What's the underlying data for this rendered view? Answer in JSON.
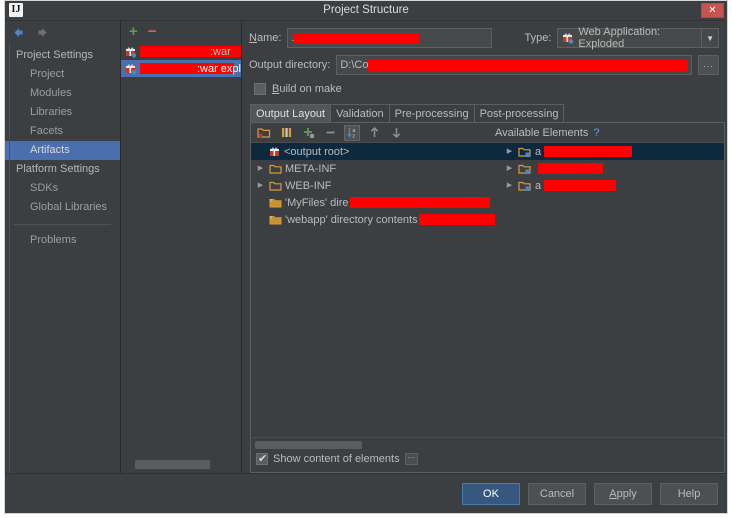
{
  "window": {
    "title": "Project Structure",
    "app_icon": "IJ",
    "close_label": "✕"
  },
  "nav": {
    "back_icon": "arrow-left-icon",
    "forward_icon": "arrow-right-icon",
    "groups": [
      {
        "label": "Project Settings",
        "items": [
          {
            "label": "Project",
            "selected": false
          },
          {
            "label": "Modules",
            "selected": false
          },
          {
            "label": "Libraries",
            "selected": false
          },
          {
            "label": "Facets",
            "selected": false
          },
          {
            "label": "Artifacts",
            "selected": true
          }
        ]
      },
      {
        "label": "Platform Settings",
        "items": [
          {
            "label": "SDKs",
            "selected": false
          },
          {
            "label": "Global Libraries",
            "selected": false
          }
        ]
      }
    ],
    "problems": "Problems"
  },
  "artifacts_panel": {
    "add_label": "+",
    "remove_label": "−",
    "items": [
      {
        "redacted_width": 107,
        "suffix": ":war",
        "selected": false
      },
      {
        "redacted_width": 107,
        "suffix": ":war expl",
        "selected": true
      }
    ]
  },
  "form": {
    "name_label": "Name:",
    "name_value": ".",
    "name_redacted_width": 125,
    "type_label": "Type:",
    "type_value": "Web Application: Exploded",
    "output_dir_label": "Output directory:",
    "output_dir_value": "D:\\Co",
    "output_dir_redacted_width": 337,
    "browse_label": "...",
    "build_on_make_label": "Build on make",
    "build_on_make_checked": false
  },
  "tabs": [
    {
      "label": "Output Layout",
      "active": true
    },
    {
      "label": "Validation",
      "active": false
    },
    {
      "label": "Pre-processing",
      "active": false
    },
    {
      "label": "Post-processing",
      "active": false
    }
  ],
  "layout_toolbar": {
    "buttons": [
      {
        "icon": "add-folder-icon",
        "pressed": false
      },
      {
        "icon": "columns-icon",
        "pressed": false
      },
      {
        "icon": "plus-icon",
        "pressed": false
      },
      {
        "icon": "minus-icon",
        "pressed": false
      },
      {
        "icon": "sort-alphabetical-icon",
        "pressed": true
      },
      {
        "icon": "arrow-up-icon",
        "pressed": false
      },
      {
        "icon": "arrow-down-icon",
        "pressed": false
      }
    ],
    "available_elements_label": "Available Elements",
    "help_label": "?"
  },
  "output_tree": [
    {
      "label": "<output root>",
      "icon": "artifact-icon",
      "twisty": "",
      "selected": true,
      "indent": 0,
      "redacted_width": 0
    },
    {
      "label": "META-INF",
      "icon": "folder-icon",
      "twisty": "▶",
      "selected": false,
      "indent": 0,
      "redacted_width": 0
    },
    {
      "label": "WEB-INF",
      "icon": "folder-icon",
      "twisty": "▶",
      "selected": false,
      "indent": 0,
      "redacted_width": 0
    },
    {
      "label": "'MyFiles' dire",
      "icon": "folder-link-icon",
      "twisty": "",
      "selected": false,
      "indent": 1,
      "redacted_width": 140
    },
    {
      "label": "'webapp' directory contents",
      "icon": "folder-link-icon",
      "twisty": "",
      "selected": false,
      "indent": 1,
      "redacted_width": 82
    }
  ],
  "available_tree": [
    {
      "icon": "module-folder-icon",
      "twisty": "▶",
      "selected": true,
      "prefix": "a",
      "redacted_width": 88
    },
    {
      "icon": "module-folder-icon",
      "twisty": "▶",
      "selected": false,
      "prefix": "",
      "redacted_width": 65
    },
    {
      "icon": "module-folder-icon",
      "twisty": "▶",
      "selected": false,
      "prefix": "a",
      "redacted_width": 72
    }
  ],
  "footer": {
    "show_content_label": "Show content of elements",
    "show_content_checked": true,
    "dots_label": "···"
  },
  "buttons": [
    {
      "label": "OK",
      "default": true
    },
    {
      "label": "Cancel",
      "default": false
    },
    {
      "label": "Apply",
      "default": false,
      "mnemonic": "A"
    },
    {
      "label": "Help",
      "default": false
    }
  ],
  "colors": {
    "window_bg": "#3c3f41",
    "selection_blue": "#4b6eaf",
    "tree_selection": "#0d293e",
    "default_button": "#365880",
    "redaction": "#fe0000",
    "close_button": "#c75450",
    "accent_green": "#6a9a55",
    "accent_red": "#c96a63",
    "link_blue": "#589df6"
  }
}
